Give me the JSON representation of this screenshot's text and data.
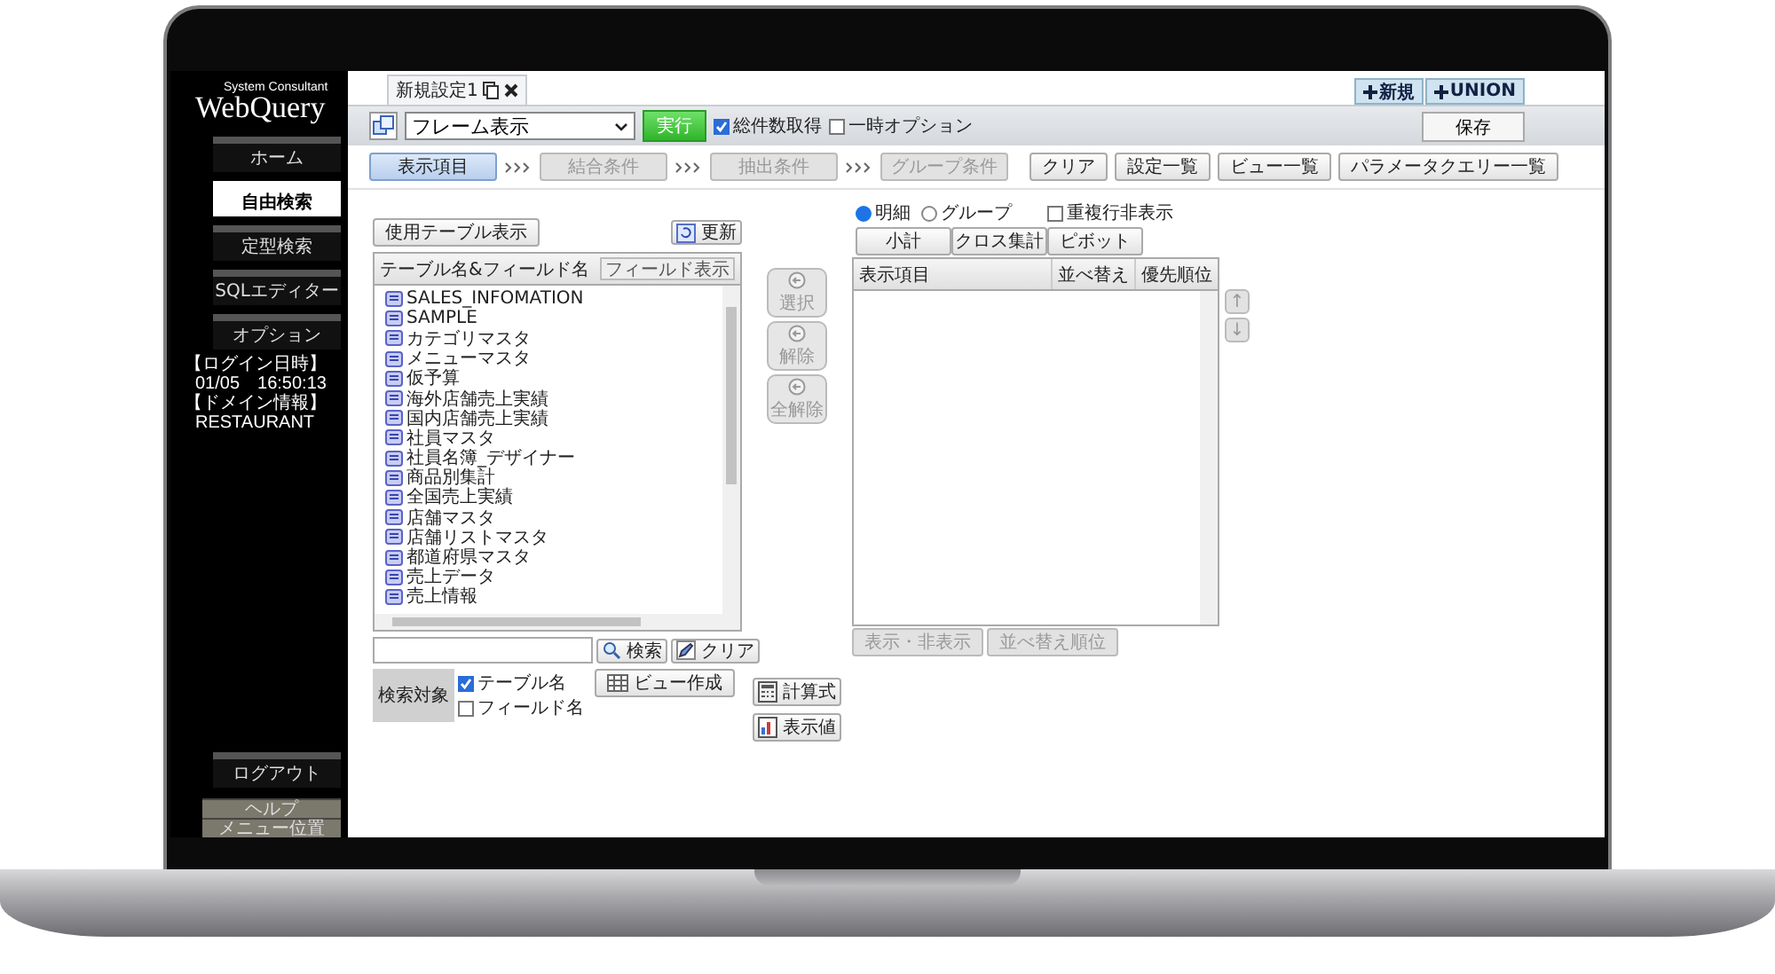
{
  "sidebar": {
    "brand_small": "System Consultant",
    "brand": "WebQuery",
    "nav": [
      {
        "label": "ホーム",
        "selected": false
      },
      {
        "label": "自由検索",
        "selected": true
      },
      {
        "label": "定型検索",
        "selected": false
      },
      {
        "label": "SQLエディター",
        "selected": false
      },
      {
        "label": "オプション",
        "selected": false
      }
    ],
    "login_label": "【ログイン日時】",
    "login_value": "01/05　16:50:13",
    "domain_label": "【ドメイン情報】",
    "domain_value": "RESTAURANT",
    "logout": "ログアウト",
    "footer": [
      "ヘルプ",
      "メニュー位置"
    ]
  },
  "tabs": [
    {
      "label": "新規設定1",
      "selected": true
    }
  ],
  "top_buttons": [
    "新規",
    "UNION"
  ],
  "toolbar": {
    "frame_select": "フレーム表示",
    "run": "実行",
    "options": [
      {
        "label": "総件数取得",
        "checked": true
      },
      {
        "label": "一時オプション",
        "checked": false
      }
    ],
    "save": "保存"
  },
  "steps": [
    {
      "label": "表示項目",
      "selected": true,
      "disabled": false
    },
    {
      "label": "結合条件",
      "selected": false,
      "disabled": true
    },
    {
      "label": "抽出条件",
      "selected": false,
      "disabled": true
    },
    {
      "label": "グループ条件",
      "selected": false,
      "disabled": true
    }
  ],
  "step_actions": [
    "クリア",
    "設定一覧",
    "ビュー一覧",
    "パラメータクエリー一覧"
  ],
  "left": {
    "show_tables": "使用テーブル表示",
    "refresh": "更新",
    "tree_header": "テーブル名&フィールド名",
    "field_toggle": "フィールド表示",
    "tables": [
      "SALES_INFOMATION",
      "SAMPLE",
      "カテゴリマスタ",
      "メニューマスタ",
      "仮予算",
      "海外店舗売上実績",
      "国内店舗売上実績",
      "社員マスタ",
      "社員名簿_デザイナー",
      "商品別集計",
      "全国売上実績",
      "店舗マスタ",
      "店舗リストマスタ",
      "都道府県マスタ",
      "売上データ",
      "売上情報"
    ],
    "search": "検索",
    "clear": "クリア",
    "search_target_label": "検索対象",
    "targets": [
      {
        "label": "テーブル名",
        "checked": true
      },
      {
        "label": "フィールド名",
        "checked": false
      }
    ],
    "create_view": "ビュー作成"
  },
  "move_buttons": [
    {
      "label": "選択",
      "disabled": true
    },
    {
      "label": "解除",
      "disabled": true
    },
    {
      "label": "全解除",
      "disabled": true
    }
  ],
  "formula_buttons": [
    "計算式",
    "表示値"
  ],
  "right": {
    "modes": [
      {
        "label": "明細",
        "selected": true
      },
      {
        "label": "グループ",
        "selected": false
      }
    ],
    "hide_duplicates": {
      "label": "重複行非表示",
      "checked": false
    },
    "agg_buttons": [
      "小計",
      "クロス集計",
      "ピボット"
    ],
    "columns": [
      "表示項目",
      "並べ替え",
      "優先順位"
    ],
    "arrows": [
      {
        "label": "↑",
        "disabled": true
      },
      {
        "label": "↓",
        "disabled": true
      }
    ],
    "bottom_buttons": [
      {
        "label": "表示・非表示",
        "disabled": true
      },
      {
        "label": "並べ替え順位",
        "disabled": true
      }
    ]
  }
}
